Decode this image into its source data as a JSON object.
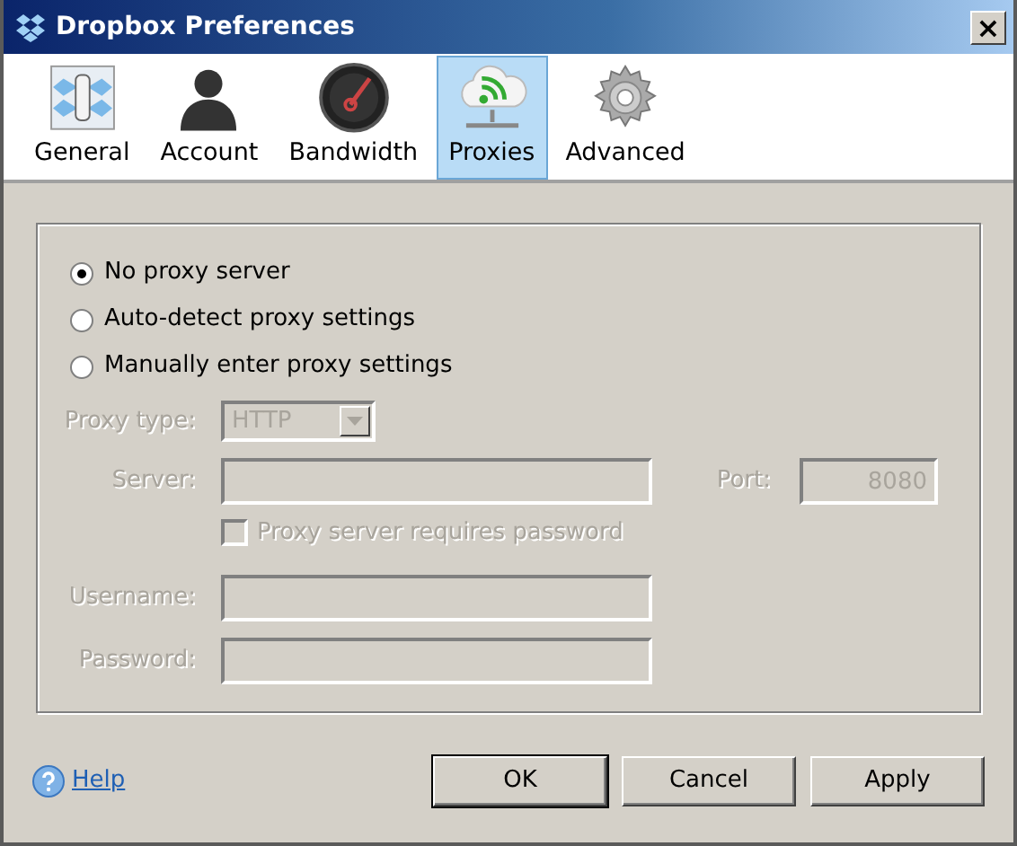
{
  "window": {
    "title": "Dropbox Preferences",
    "close": "×"
  },
  "tabs": [
    {
      "label": "General",
      "selected": false
    },
    {
      "label": "Account",
      "selected": false
    },
    {
      "label": "Bandwidth",
      "selected": false
    },
    {
      "label": "Proxies",
      "selected": true
    },
    {
      "label": "Advanced",
      "selected": false
    }
  ],
  "proxy_options": [
    {
      "label": "No proxy server",
      "selected": true
    },
    {
      "label": "Auto-detect proxy settings",
      "selected": false
    },
    {
      "label": "Manually enter proxy settings",
      "selected": false
    }
  ],
  "proxy_type": {
    "label": "Proxy type:",
    "value": "HTTP",
    "disabled": true
  },
  "server": {
    "label": "Server:",
    "disabled": true
  },
  "port": {
    "label": "Port:",
    "value": "8080",
    "disabled": true
  },
  "requires_password": {
    "label": "Proxy server requires password",
    "checked": false,
    "disabled": true
  },
  "username": {
    "label": "Username:",
    "disabled": true
  },
  "password": {
    "label": "Password:",
    "disabled": true
  },
  "help": {
    "label": "Help"
  },
  "buttons": [
    {
      "label": "OK",
      "default": true
    },
    {
      "label": "Cancel",
      "default": false
    },
    {
      "label": "Apply",
      "default": false
    }
  ]
}
